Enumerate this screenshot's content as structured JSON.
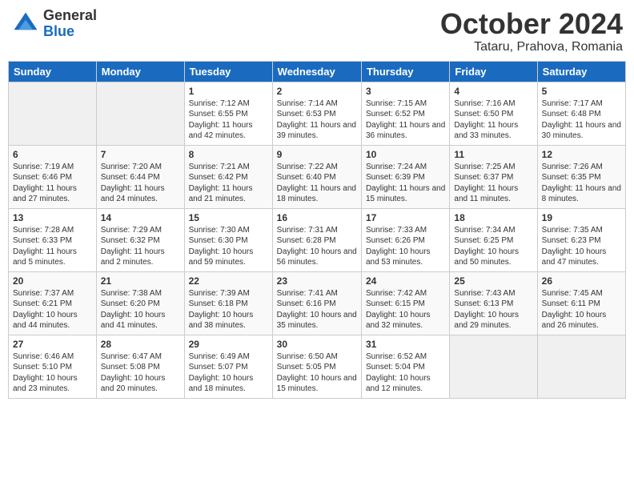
{
  "logo": {
    "general": "General",
    "blue": "Blue"
  },
  "title": "October 2024",
  "location": "Tataru, Prahova, Romania",
  "weekdays": [
    "Sunday",
    "Monday",
    "Tuesday",
    "Wednesday",
    "Thursday",
    "Friday",
    "Saturday"
  ],
  "weeks": [
    [
      {
        "day": "",
        "empty": true
      },
      {
        "day": "",
        "empty": true
      },
      {
        "day": "1",
        "sunrise": "Sunrise: 7:12 AM",
        "sunset": "Sunset: 6:55 PM",
        "daylight": "Daylight: 11 hours and 42 minutes."
      },
      {
        "day": "2",
        "sunrise": "Sunrise: 7:14 AM",
        "sunset": "Sunset: 6:53 PM",
        "daylight": "Daylight: 11 hours and 39 minutes."
      },
      {
        "day": "3",
        "sunrise": "Sunrise: 7:15 AM",
        "sunset": "Sunset: 6:52 PM",
        "daylight": "Daylight: 11 hours and 36 minutes."
      },
      {
        "day": "4",
        "sunrise": "Sunrise: 7:16 AM",
        "sunset": "Sunset: 6:50 PM",
        "daylight": "Daylight: 11 hours and 33 minutes."
      },
      {
        "day": "5",
        "sunrise": "Sunrise: 7:17 AM",
        "sunset": "Sunset: 6:48 PM",
        "daylight": "Daylight: 11 hours and 30 minutes."
      }
    ],
    [
      {
        "day": "6",
        "sunrise": "Sunrise: 7:19 AM",
        "sunset": "Sunset: 6:46 PM",
        "daylight": "Daylight: 11 hours and 27 minutes."
      },
      {
        "day": "7",
        "sunrise": "Sunrise: 7:20 AM",
        "sunset": "Sunset: 6:44 PM",
        "daylight": "Daylight: 11 hours and 24 minutes."
      },
      {
        "day": "8",
        "sunrise": "Sunrise: 7:21 AM",
        "sunset": "Sunset: 6:42 PM",
        "daylight": "Daylight: 11 hours and 21 minutes."
      },
      {
        "day": "9",
        "sunrise": "Sunrise: 7:22 AM",
        "sunset": "Sunset: 6:40 PM",
        "daylight": "Daylight: 11 hours and 18 minutes."
      },
      {
        "day": "10",
        "sunrise": "Sunrise: 7:24 AM",
        "sunset": "Sunset: 6:39 PM",
        "daylight": "Daylight: 11 hours and 15 minutes."
      },
      {
        "day": "11",
        "sunrise": "Sunrise: 7:25 AM",
        "sunset": "Sunset: 6:37 PM",
        "daylight": "Daylight: 11 hours and 11 minutes."
      },
      {
        "day": "12",
        "sunrise": "Sunrise: 7:26 AM",
        "sunset": "Sunset: 6:35 PM",
        "daylight": "Daylight: 11 hours and 8 minutes."
      }
    ],
    [
      {
        "day": "13",
        "sunrise": "Sunrise: 7:28 AM",
        "sunset": "Sunset: 6:33 PM",
        "daylight": "Daylight: 11 hours and 5 minutes."
      },
      {
        "day": "14",
        "sunrise": "Sunrise: 7:29 AM",
        "sunset": "Sunset: 6:32 PM",
        "daylight": "Daylight: 11 hours and 2 minutes."
      },
      {
        "day": "15",
        "sunrise": "Sunrise: 7:30 AM",
        "sunset": "Sunset: 6:30 PM",
        "daylight": "Daylight: 10 hours and 59 minutes."
      },
      {
        "day": "16",
        "sunrise": "Sunrise: 7:31 AM",
        "sunset": "Sunset: 6:28 PM",
        "daylight": "Daylight: 10 hours and 56 minutes."
      },
      {
        "day": "17",
        "sunrise": "Sunrise: 7:33 AM",
        "sunset": "Sunset: 6:26 PM",
        "daylight": "Daylight: 10 hours and 53 minutes."
      },
      {
        "day": "18",
        "sunrise": "Sunrise: 7:34 AM",
        "sunset": "Sunset: 6:25 PM",
        "daylight": "Daylight: 10 hours and 50 minutes."
      },
      {
        "day": "19",
        "sunrise": "Sunrise: 7:35 AM",
        "sunset": "Sunset: 6:23 PM",
        "daylight": "Daylight: 10 hours and 47 minutes."
      }
    ],
    [
      {
        "day": "20",
        "sunrise": "Sunrise: 7:37 AM",
        "sunset": "Sunset: 6:21 PM",
        "daylight": "Daylight: 10 hours and 44 minutes."
      },
      {
        "day": "21",
        "sunrise": "Sunrise: 7:38 AM",
        "sunset": "Sunset: 6:20 PM",
        "daylight": "Daylight: 10 hours and 41 minutes."
      },
      {
        "day": "22",
        "sunrise": "Sunrise: 7:39 AM",
        "sunset": "Sunset: 6:18 PM",
        "daylight": "Daylight: 10 hours and 38 minutes."
      },
      {
        "day": "23",
        "sunrise": "Sunrise: 7:41 AM",
        "sunset": "Sunset: 6:16 PM",
        "daylight": "Daylight: 10 hours and 35 minutes."
      },
      {
        "day": "24",
        "sunrise": "Sunrise: 7:42 AM",
        "sunset": "Sunset: 6:15 PM",
        "daylight": "Daylight: 10 hours and 32 minutes."
      },
      {
        "day": "25",
        "sunrise": "Sunrise: 7:43 AM",
        "sunset": "Sunset: 6:13 PM",
        "daylight": "Daylight: 10 hours and 29 minutes."
      },
      {
        "day": "26",
        "sunrise": "Sunrise: 7:45 AM",
        "sunset": "Sunset: 6:11 PM",
        "daylight": "Daylight: 10 hours and 26 minutes."
      }
    ],
    [
      {
        "day": "27",
        "sunrise": "Sunrise: 6:46 AM",
        "sunset": "Sunset: 5:10 PM",
        "daylight": "Daylight: 10 hours and 23 minutes."
      },
      {
        "day": "28",
        "sunrise": "Sunrise: 6:47 AM",
        "sunset": "Sunset: 5:08 PM",
        "daylight": "Daylight: 10 hours and 20 minutes."
      },
      {
        "day": "29",
        "sunrise": "Sunrise: 6:49 AM",
        "sunset": "Sunset: 5:07 PM",
        "daylight": "Daylight: 10 hours and 18 minutes."
      },
      {
        "day": "30",
        "sunrise": "Sunrise: 6:50 AM",
        "sunset": "Sunset: 5:05 PM",
        "daylight": "Daylight: 10 hours and 15 minutes."
      },
      {
        "day": "31",
        "sunrise": "Sunrise: 6:52 AM",
        "sunset": "Sunset: 5:04 PM",
        "daylight": "Daylight: 10 hours and 12 minutes."
      },
      {
        "day": "",
        "empty": true
      },
      {
        "day": "",
        "empty": true
      }
    ]
  ]
}
